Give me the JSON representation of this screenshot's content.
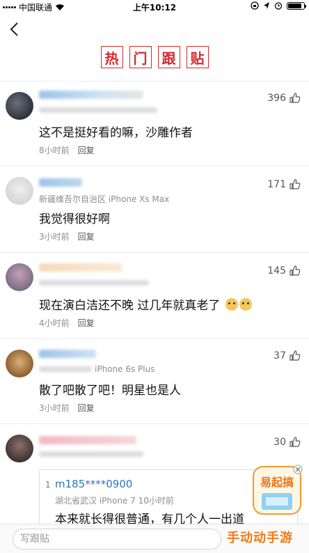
{
  "status_bar": {
    "carrier": "中国联通",
    "time": "上午10:12",
    "battery_level": 0.85
  },
  "page": {
    "title_chars": [
      "热",
      "门",
      "跟",
      "贴"
    ]
  },
  "comments": [
    {
      "location": "",
      "content": "这不是挺好看的嘛，沙雕作者",
      "time": "8小时前",
      "reply": "回复",
      "likes": "396"
    },
    {
      "location": "新疆维吾尔自治区 iPhone Xs Max",
      "content": "我觉得很好啊",
      "time": "3小时前",
      "reply": "回复",
      "likes": "171"
    },
    {
      "location": "",
      "content": "现在演白洁还不晚 过几年就真老了",
      "time": "4小时前",
      "reply": "回复",
      "likes": "145"
    },
    {
      "location": "iPhone 6s Plus",
      "content": "散了吧散了吧！明星也是人",
      "time": "3小时前",
      "reply": "回复",
      "likes": "37"
    },
    {
      "location": "",
      "content": "",
      "time": "",
      "reply": "",
      "likes": "30"
    }
  ],
  "quoted_reply": {
    "number": "1",
    "user": "m185****0900",
    "location": "湖北省武汉 iPhone 7 10小时前",
    "text": "本来就长得很普通，有几个人一出道"
  },
  "reply_bar": {
    "placeholder": "写跟贴"
  },
  "badge": {
    "text": "易起搞"
  },
  "watermark": {
    "text": "手动动手游"
  }
}
